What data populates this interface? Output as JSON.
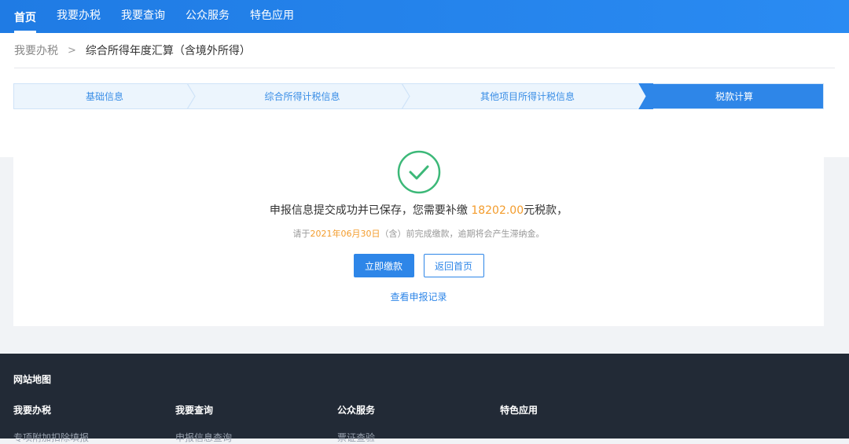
{
  "nav": {
    "items": [
      "首页",
      "我要办税",
      "我要查询",
      "公众服务",
      "特色应用"
    ],
    "active_index": 0
  },
  "breadcrumb": {
    "parent": "我要办税",
    "separator": ">",
    "current": "综合所得年度汇算（含境外所得）"
  },
  "steps": {
    "items": [
      "基础信息",
      "综合所得计税信息",
      "其他项目所得计税信息",
      "税款计算"
    ],
    "active_index": 3
  },
  "result": {
    "message_prefix": "申报信息提交成功并已保存，您需要补缴 ",
    "amount": "18202.00",
    "message_suffix": "元税款，",
    "sub_prefix": "请于",
    "due_date": "2021年06月30日",
    "sub_suffix": "（含）前完成缴款，逾期将会产生滞纳金。",
    "pay_button": "立即缴款",
    "home_button": "返回首页",
    "records_link": "查看申报记录"
  },
  "footer": {
    "title": "网站地图",
    "columns": [
      {
        "heading": "我要办税",
        "links": [
          "专项附加扣除填报"
        ]
      },
      {
        "heading": "我要查询",
        "links": [
          "申报信息查询"
        ]
      },
      {
        "heading": "公众服务",
        "links": [
          "票证查验"
        ]
      },
      {
        "heading": "特色应用",
        "links": []
      }
    ]
  },
  "colors": {
    "primary": "#2e86e8",
    "amount": "#f39c2c",
    "success": "#3cb878",
    "footer_bg": "#222a36"
  }
}
